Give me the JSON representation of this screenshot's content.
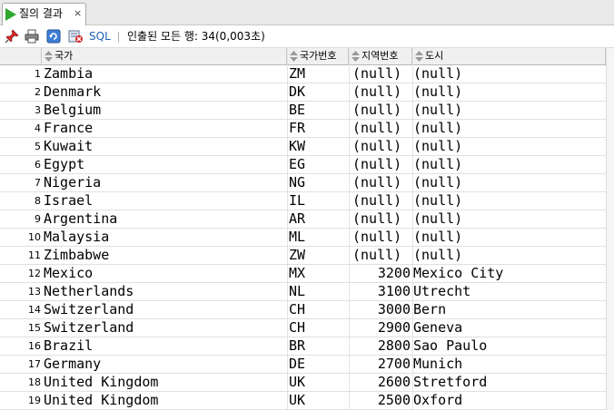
{
  "tab": {
    "title": "질의 결과",
    "close": "×"
  },
  "toolbar": {
    "sql_label": "SQL",
    "status": "인출된 모든 행: 34(0,003초)"
  },
  "grid": {
    "columns": [
      "국가",
      "국가번호",
      "지역번호",
      "도시"
    ],
    "rows": [
      {
        "n": "1",
        "country": "Zambia",
        "code": "ZM",
        "region": "(null)",
        "city": "(null)"
      },
      {
        "n": "2",
        "country": "Denmark",
        "code": "DK",
        "region": "(null)",
        "city": "(null)"
      },
      {
        "n": "3",
        "country": "Belgium",
        "code": "BE",
        "region": "(null)",
        "city": "(null)"
      },
      {
        "n": "4",
        "country": "France",
        "code": "FR",
        "region": "(null)",
        "city": "(null)"
      },
      {
        "n": "5",
        "country": "Kuwait",
        "code": "KW",
        "region": "(null)",
        "city": "(null)"
      },
      {
        "n": "6",
        "country": "Egypt",
        "code": "EG",
        "region": "(null)",
        "city": "(null)"
      },
      {
        "n": "7",
        "country": "Nigeria",
        "code": "NG",
        "region": "(null)",
        "city": "(null)"
      },
      {
        "n": "8",
        "country": "Israel",
        "code": "IL",
        "region": "(null)",
        "city": "(null)"
      },
      {
        "n": "9",
        "country": "Argentina",
        "code": "AR",
        "region": "(null)",
        "city": "(null)"
      },
      {
        "n": "10",
        "country": "Malaysia",
        "code": "ML",
        "region": "(null)",
        "city": "(null)"
      },
      {
        "n": "11",
        "country": "Zimbabwe",
        "code": "ZW",
        "region": "(null)",
        "city": "(null)"
      },
      {
        "n": "12",
        "country": "Mexico",
        "code": "MX",
        "region": "3200",
        "city": "Mexico City"
      },
      {
        "n": "13",
        "country": "Netherlands",
        "code": "NL",
        "region": "3100",
        "city": "Utrecht"
      },
      {
        "n": "14",
        "country": "Switzerland",
        "code": "CH",
        "region": "3000",
        "city": "Bern"
      },
      {
        "n": "15",
        "country": "Switzerland",
        "code": "CH",
        "region": "2900",
        "city": "Geneva"
      },
      {
        "n": "16",
        "country": "Brazil",
        "code": "BR",
        "region": "2800",
        "city": "Sao Paulo"
      },
      {
        "n": "17",
        "country": "Germany",
        "code": "DE",
        "region": "2700",
        "city": "Munich"
      },
      {
        "n": "18",
        "country": "United Kingdom",
        "code": "UK",
        "region": "2600",
        "city": "Stretford"
      },
      {
        "n": "19",
        "country": "United Kingdom",
        "code": "UK",
        "region": "2500",
        "city": "Oxford"
      }
    ]
  }
}
